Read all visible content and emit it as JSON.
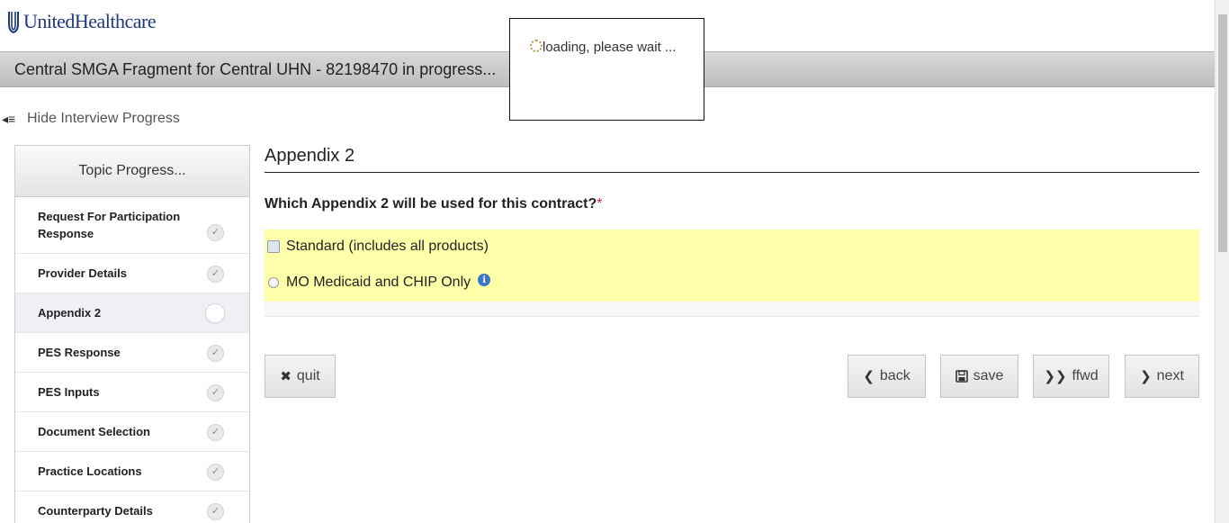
{
  "header": {
    "logo_text": "UnitedHealthcare",
    "logo_icon": "uhc-shield-icon",
    "title": "Central SMGA Fragment for Central UHN - 82198470 in progress..."
  },
  "progress_toggle": {
    "icon": "collapse-menu-icon",
    "label": "Hide Interview Progress"
  },
  "sidebar": {
    "heading": "Topic Progress...",
    "items": [
      {
        "label": "Request For Participation Response",
        "state": "complete"
      },
      {
        "label": "Provider Details",
        "state": "complete"
      },
      {
        "label": "Appendix 2",
        "state": "current"
      },
      {
        "label": "PES Response",
        "state": "complete"
      },
      {
        "label": "PES Inputs",
        "state": "complete"
      },
      {
        "label": "Document Selection",
        "state": "complete"
      },
      {
        "label": "Practice Locations",
        "state": "complete"
      },
      {
        "label": "Counterparty Details",
        "state": "complete"
      }
    ]
  },
  "main": {
    "section_title": "Appendix 2",
    "question": "Which Appendix 2 will be used for this contract?",
    "required_marker": "*",
    "options": [
      {
        "label": "Standard (includes all products)"
      },
      {
        "label": "MO Medicaid and CHIP Only",
        "has_info": true
      }
    ]
  },
  "buttons": {
    "quit": "quit",
    "back": "back",
    "save": "save",
    "ffwd": "ffwd",
    "next": "next"
  },
  "loading": {
    "message": "loading, please wait ..."
  },
  "colors": {
    "options_background": "#ffffaa",
    "logo_blue": "#1d3a7c",
    "info_blue": "#3a77c8"
  }
}
